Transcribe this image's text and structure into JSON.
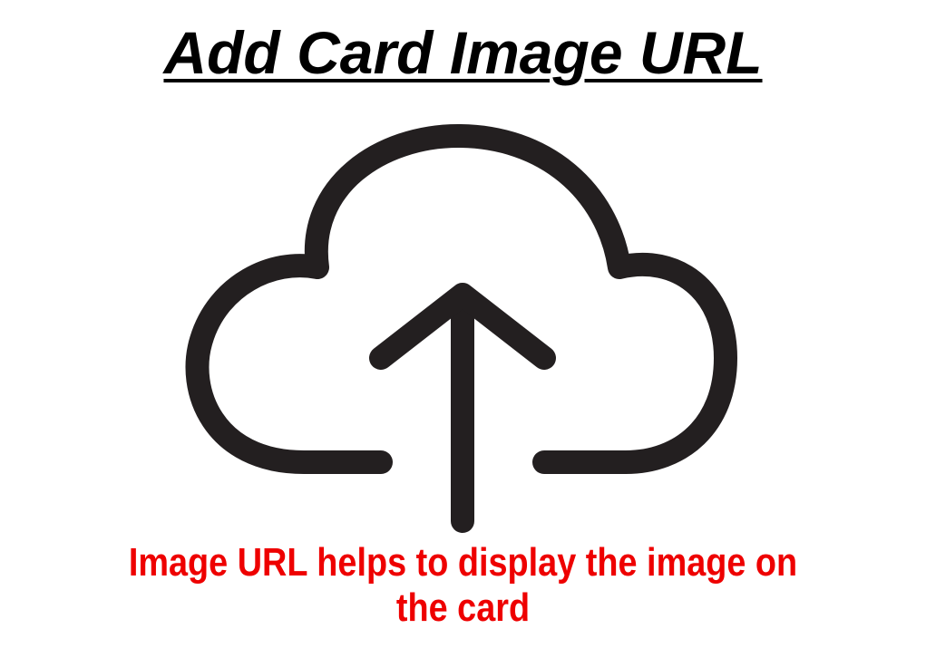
{
  "title": "Add Card Image URL",
  "icon": "cloud-upload-icon",
  "caption": "Image URL helps to display the image on the card",
  "colors": {
    "title": "#000000",
    "icon": "#231f20",
    "caption": "#ee0000"
  }
}
